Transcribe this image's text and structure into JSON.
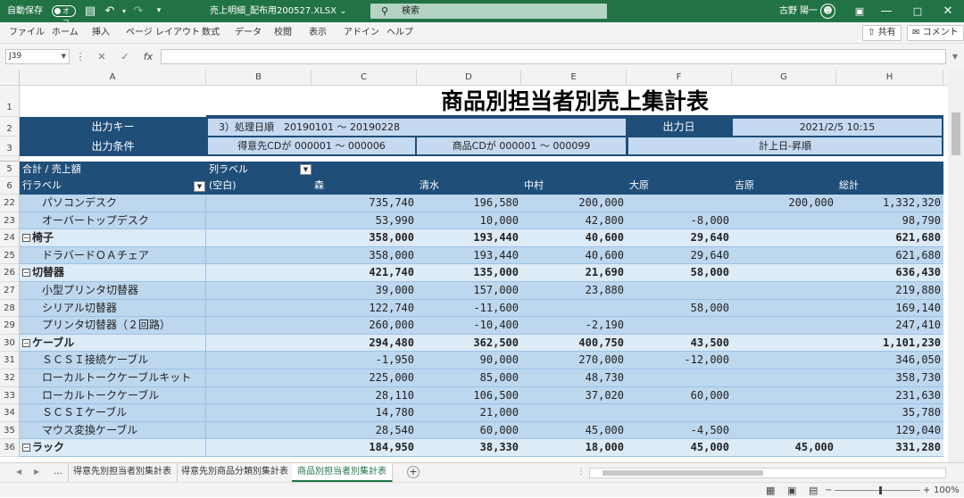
{
  "titlebar": {
    "autosave_label": "自動保存",
    "autosave_state": "オフ",
    "file_title": "売上明細_配布用200527.XLSX",
    "file_title_arrow": "⌄",
    "search_placeholder": "検索",
    "user_name": "古野 陽一"
  },
  "menu": {
    "items": [
      "ファイル",
      "ホーム",
      "挿入",
      "ページ レイアウト",
      "数式",
      "データ",
      "校閲",
      "表示",
      "アドイン",
      "ヘルプ"
    ],
    "share_label": "共有",
    "comment_label": "コメント"
  },
  "formula_bar": {
    "name_box": "J39",
    "formula": ""
  },
  "columns": [
    "A",
    "B",
    "C",
    "D",
    "E",
    "F",
    "G",
    "H"
  ],
  "report": {
    "title": "商品別担当者別売上集計表",
    "output_key_label": "出力キー",
    "output_key_value": "3）処理日順　20190101 〜 20190228",
    "output_date_label": "出力日",
    "output_date_value": "2021/2/5 10:15",
    "output_cond_label": "出力条件",
    "cond_customer": "得意先CDが 000001 〜 000006",
    "cond_product": "商品CDが 000001 〜 000099",
    "cond_order": "計上日-昇順"
  },
  "pivot": {
    "corner_label": "合計 / 売上額",
    "col_label": "列ラベル",
    "row_label": "行ラベル",
    "headers": [
      "(空白)",
      "森",
      "清水",
      "中村",
      "大原",
      "吉原",
      "総計"
    ]
  },
  "rows": [
    {
      "num": "22",
      "label": "パソコンデスク",
      "level": 1,
      "vals": [
        "",
        "735,740",
        "196,580",
        "200,000",
        "",
        "200,000",
        "1,332,320"
      ]
    },
    {
      "num": "23",
      "label": "オーバートップデスク",
      "level": 1,
      "vals": [
        "",
        "53,990",
        "10,000",
        "42,800",
        "-8,000",
        "",
        "98,790"
      ]
    },
    {
      "num": "24",
      "label": "椅子",
      "level": 0,
      "vals": [
        "",
        "358,000",
        "193,440",
        "40,600",
        "29,640",
        "",
        "621,680"
      ]
    },
    {
      "num": "25",
      "label": "ドラバードＯＡチェア",
      "level": 1,
      "vals": [
        "",
        "358,000",
        "193,440",
        "40,600",
        "29,640",
        "",
        "621,680"
      ]
    },
    {
      "num": "26",
      "label": "切替器",
      "level": 0,
      "vals": [
        "",
        "421,740",
        "135,000",
        "21,690",
        "58,000",
        "",
        "636,430"
      ]
    },
    {
      "num": "27",
      "label": "小型プリンタ切替器",
      "level": 1,
      "vals": [
        "",
        "39,000",
        "157,000",
        "23,880",
        "",
        "",
        "219,880"
      ]
    },
    {
      "num": "28",
      "label": "シリアル切替器",
      "level": 1,
      "vals": [
        "",
        "122,740",
        "-11,600",
        "",
        "58,000",
        "",
        "169,140"
      ]
    },
    {
      "num": "29",
      "label": "プリンタ切替器（２回路）",
      "level": 1,
      "vals": [
        "",
        "260,000",
        "-10,400",
        "-2,190",
        "",
        "",
        "247,410"
      ]
    },
    {
      "num": "30",
      "label": "ケーブル",
      "level": 0,
      "vals": [
        "",
        "294,480",
        "362,500",
        "400,750",
        "43,500",
        "",
        "1,101,230"
      ]
    },
    {
      "num": "31",
      "label": "ＳＣＳＩ接続ケーブル",
      "level": 1,
      "vals": [
        "",
        "-1,950",
        "90,000",
        "270,000",
        "-12,000",
        "",
        "346,050"
      ]
    },
    {
      "num": "32",
      "label": "ローカルトークケーブルキット",
      "level": 1,
      "vals": [
        "",
        "225,000",
        "85,000",
        "48,730",
        "",
        "",
        "358,730"
      ]
    },
    {
      "num": "33",
      "label": "ローカルトークケーブル",
      "level": 1,
      "vals": [
        "",
        "28,110",
        "106,500",
        "37,020",
        "60,000",
        "",
        "231,630"
      ]
    },
    {
      "num": "34",
      "label": "ＳＣＳＩケーブル",
      "level": 1,
      "vals": [
        "",
        "14,780",
        "21,000",
        "",
        "",
        "",
        "35,780"
      ]
    },
    {
      "num": "35",
      "label": "マウス変換ケーブル",
      "level": 1,
      "vals": [
        "",
        "28,540",
        "60,000",
        "45,000",
        "-4,500",
        "",
        "129,040"
      ]
    },
    {
      "num": "36",
      "label": "ラック",
      "level": 0,
      "vals": [
        "",
        "184,950",
        "38,330",
        "18,000",
        "45,000",
        "45,000",
        "331,280"
      ]
    }
  ],
  "header_row_nums": [
    "1",
    "2",
    "3",
    "5",
    "6"
  ],
  "tabs": {
    "ellipsis": "...",
    "items": [
      "得意先別担当者別集計表",
      "得意先別商品分類別集計表",
      "商品別担当者別集計表"
    ],
    "active_index": 2
  },
  "status": {
    "zoom": "100%"
  }
}
